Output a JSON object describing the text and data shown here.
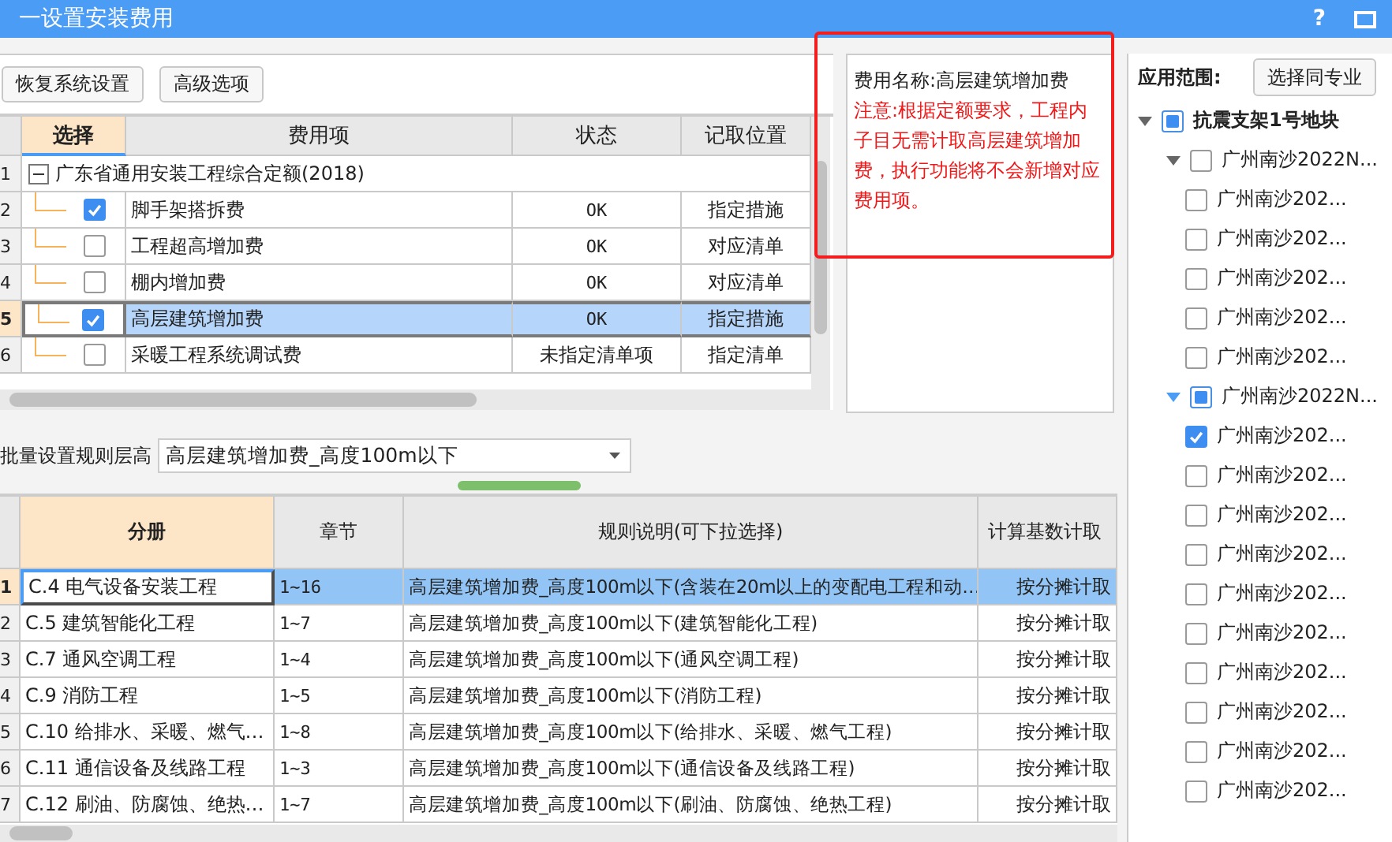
{
  "window": {
    "title": "一设置安装费用",
    "help": "?"
  },
  "toolbar": {
    "buttons": [
      "恢复系统设置",
      "高级选项"
    ]
  },
  "fee_grid": {
    "columns": [
      {
        "label": "选择",
        "selected": true
      },
      {
        "label": "费用项",
        "selected": false
      },
      {
        "label": "状态",
        "selected": false
      },
      {
        "label": "记取位置",
        "selected": false
      }
    ],
    "rows": [
      {
        "number": "1",
        "kind": "group",
        "label": "广东省通用安装工程综合定额(2018)",
        "expanded": true,
        "selected": false
      },
      {
        "number": "2",
        "kind": "item",
        "checked": true,
        "fee": "脚手架搭拆费",
        "status": "OK",
        "location": "指定措施",
        "selected": false
      },
      {
        "number": "3",
        "kind": "item",
        "checked": false,
        "fee": "工程超高增加费",
        "status": "OK",
        "location": "对应清单",
        "selected": false
      },
      {
        "number": "4",
        "kind": "item",
        "checked": false,
        "fee": "棚内增加费",
        "status": "OK",
        "location": "对应清单",
        "selected": false
      },
      {
        "number": "5",
        "kind": "item",
        "checked": true,
        "fee": "高层建筑增加费",
        "status": "OK",
        "location": "指定措施",
        "selected": true
      },
      {
        "number": "6",
        "kind": "item",
        "checked": false,
        "fee": "采暖工程系统调试费",
        "status": "未指定清单项",
        "location": "指定清单",
        "selected": false
      }
    ]
  },
  "note": {
    "title": "费用名称:高层建筑增加费",
    "warning": "注意:根据定额要求，工程内子目无需计取高层建筑增加费，执行功能将不会新增对应费用项。"
  },
  "batch": {
    "label": "批量设置规则层高",
    "value": "高层建筑增加费_高度100m以下"
  },
  "rule_grid": {
    "columns": [
      {
        "label": "分册",
        "selected": true
      },
      {
        "label": "章节",
        "selected": false
      },
      {
        "label": "规则说明(可下拉选择)",
        "selected": false
      },
      {
        "label": "计算基数计取",
        "selected": false
      }
    ],
    "rows": [
      {
        "number": "1",
        "volume": "C.4 电气设备安装工程",
        "chapters": "1~16",
        "rule": "高层建筑增加费_高度100m以下(含装在20m以上的变配电工程和动…",
        "base": "按分摊计取",
        "selected": true
      },
      {
        "number": "2",
        "volume": "C.5 建筑智能化工程",
        "chapters": "1~7",
        "rule": "高层建筑增加费_高度100m以下(建筑智能化工程)",
        "base": "按分摊计取",
        "selected": false
      },
      {
        "number": "3",
        "volume": "C.7 通风空调工程",
        "chapters": "1~4",
        "rule": "高层建筑增加费_高度100m以下(通风空调工程)",
        "base": "按分摊计取",
        "selected": false
      },
      {
        "number": "4",
        "volume": "C.9 消防工程",
        "chapters": "1~5",
        "rule": "高层建筑增加费_高度100m以下(消防工程)",
        "base": "按分摊计取",
        "selected": false
      },
      {
        "number": "5",
        "volume": "C.10 给排水、采暖、燃气…",
        "chapters": "1~8",
        "rule": "高层建筑增加费_高度100m以下(给排水、采暖、燃气工程)",
        "base": "按分摊计取",
        "selected": false
      },
      {
        "number": "6",
        "volume": "C.11 通信设备及线路工程",
        "chapters": "1~3",
        "rule": "高层建筑增加费_高度100m以下(通信设备及线路工程)",
        "base": "按分摊计取",
        "selected": false
      },
      {
        "number": "7",
        "volume": "C.12 刷油、防腐蚀、绝热…",
        "chapters": "1~7",
        "rule": "高层建筑增加费_高度100m以下(刷油、防腐蚀、绝热工程)",
        "base": "按分摊计取",
        "selected": false
      }
    ]
  },
  "scope": {
    "label": "应用范围:",
    "button": "选择同专业",
    "tree": [
      {
        "label": "抗震支架1号地块",
        "checked": false,
        "partial": true,
        "expanded": true,
        "children": [
          {
            "label": "广州南沙2022N...",
            "checked": false,
            "partial": false,
            "expanded": true,
            "children": [
              {
                "label": "广州南沙202...",
                "checked": false
              },
              {
                "label": "广州南沙202...",
                "checked": false
              },
              {
                "label": "广州南沙202...",
                "checked": false
              },
              {
                "label": "广州南沙202...",
                "checked": false
              },
              {
                "label": "广州南沙202...",
                "checked": false
              }
            ]
          },
          {
            "label": "广州南沙2022N...",
            "checked": false,
            "partial": true,
            "expanded": true,
            "children": [
              {
                "label": "广州南沙202...",
                "checked": true
              },
              {
                "label": "广州南沙202...",
                "checked": false
              },
              {
                "label": "广州南沙202...",
                "checked": false
              },
              {
                "label": "广州南沙202...",
                "checked": false
              },
              {
                "label": "广州南沙202...",
                "checked": false
              },
              {
                "label": "广州南沙202...",
                "checked": false
              },
              {
                "label": "广州南沙202...",
                "checked": false
              },
              {
                "label": "广州南沙202...",
                "checked": false
              },
              {
                "label": "广州南沙202...",
                "checked": false
              },
              {
                "label": "广州南沙202...",
                "checked": false
              }
            ]
          }
        ]
      }
    ]
  }
}
